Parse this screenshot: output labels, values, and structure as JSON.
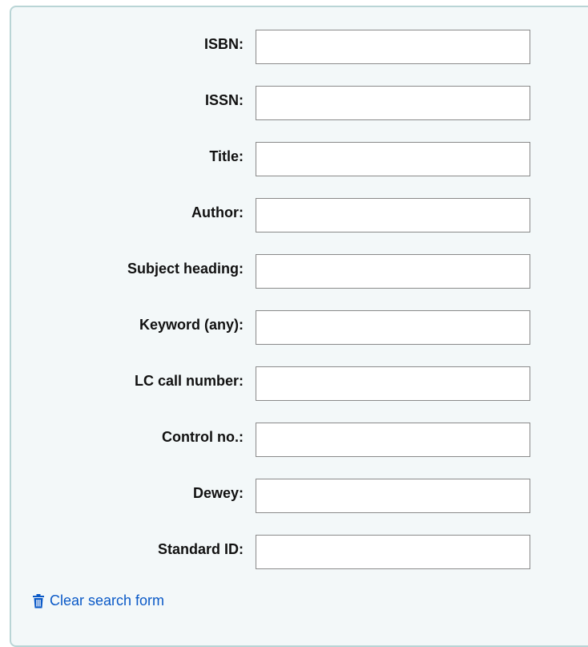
{
  "fields": [
    {
      "key": "isbn",
      "label": "ISBN:",
      "value": ""
    },
    {
      "key": "issn",
      "label": "ISSN:",
      "value": ""
    },
    {
      "key": "title",
      "label": "Title:",
      "value": ""
    },
    {
      "key": "author",
      "label": "Author:",
      "value": ""
    },
    {
      "key": "subject-heading",
      "label": "Subject heading:",
      "value": ""
    },
    {
      "key": "keyword-any",
      "label": "Keyword (any):",
      "value": ""
    },
    {
      "key": "lc-call-number",
      "label": "LC call number:",
      "value": ""
    },
    {
      "key": "control-no",
      "label": "Control no.:",
      "value": ""
    },
    {
      "key": "dewey",
      "label": "Dewey:",
      "value": ""
    },
    {
      "key": "standard-id",
      "label": "Standard ID:",
      "value": ""
    }
  ],
  "clear_link": {
    "label": "Clear search form",
    "icon": "trash-icon"
  },
  "colors": {
    "panel_background": "#f3f8f9",
    "panel_border": "#b9d5d6",
    "link": "#0a59c7"
  }
}
